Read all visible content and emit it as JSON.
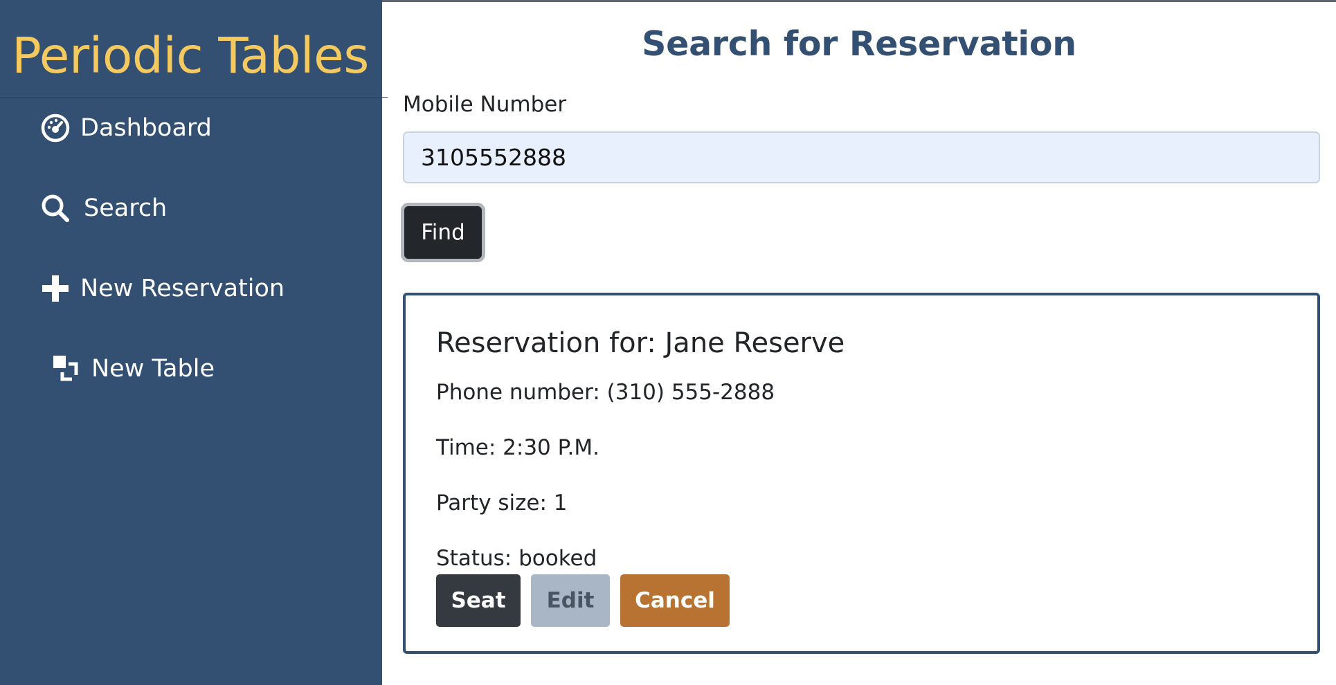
{
  "app": {
    "brand": "Periodic Tables"
  },
  "sidebar": {
    "items": [
      {
        "label": "Dashboard",
        "icon": "dashboard-gauge-icon"
      },
      {
        "label": "Search",
        "icon": "search-icon"
      },
      {
        "label": "New Reservation",
        "icon": "plus-icon"
      },
      {
        "label": "New Table",
        "icon": "stacked-squares-icon"
      }
    ]
  },
  "search": {
    "title": "Search for Reservation",
    "field_label": "Mobile Number",
    "input_value": "3105552888",
    "find_label": "Find"
  },
  "reservation": {
    "title": "Reservation for: Jane Reserve",
    "phone": "Phone number: (310) 555-2888",
    "time": "Time: 2:30 P.M.",
    "party": "Party size: 1",
    "status": "Status: booked",
    "seat_label": "Seat",
    "edit_label": "Edit",
    "cancel_label": "Cancel"
  },
  "colors": {
    "sidebar_bg": "#335073",
    "brand": "#f4c960",
    "title": "#335073",
    "card_border": "#335073",
    "input_bg": "#e8f0fe",
    "seat_bg": "#343a40",
    "edit_bg": "#a9b6c6",
    "cancel_bg": "#b87333"
  }
}
